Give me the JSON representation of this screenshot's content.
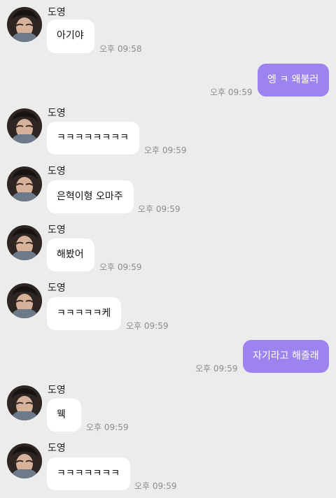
{
  "chat": {
    "messages": [
      {
        "type": "incoming",
        "sender": "도영",
        "text": "아기야",
        "time": "오후 09:58"
      },
      {
        "type": "outgoing",
        "text": "엥 ㅋ 왜불러",
        "time": "오후 09:59"
      },
      {
        "type": "incoming",
        "sender": "도영",
        "text": "ㅋㅋㅋㅋㅋㅋㅋㅋ",
        "time": "오후 09:59"
      },
      {
        "type": "incoming",
        "sender": "도영",
        "text": "은혁이형 오마주",
        "time": "오후 09:59"
      },
      {
        "type": "incoming",
        "sender": "도영",
        "text": "해봤어",
        "time": "오후 09:59"
      },
      {
        "type": "incoming",
        "sender": "도영",
        "text": "ㅋㅋㅋㅋㅋ케",
        "time": "오후 09:59"
      },
      {
        "type": "outgoing",
        "text": "자기라고 해줄래",
        "time": "오후 09:59"
      },
      {
        "type": "incoming",
        "sender": "도영",
        "text": "웩",
        "time": "오후 09:59"
      },
      {
        "type": "incoming",
        "sender": "도영",
        "text": "ㅋㅋㅋㅋㅋㅋㅋ",
        "time": "오후 09:59"
      }
    ]
  },
  "colors": {
    "background": "#ececec",
    "incoming_bubble": "#ffffff",
    "outgoing_bubble": "#9c83f0",
    "timestamp": "#8c8c8c"
  }
}
